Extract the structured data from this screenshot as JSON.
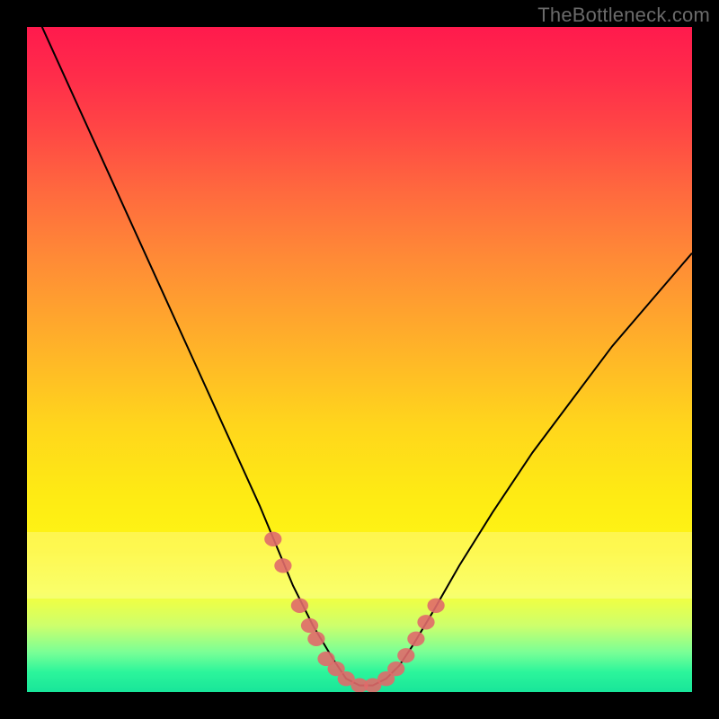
{
  "watermark": "TheBottleneck.com",
  "chart_data": {
    "type": "line",
    "title": "",
    "xlabel": "",
    "ylabel": "",
    "xlim": [
      0,
      100
    ],
    "ylim": [
      0,
      100
    ],
    "series": [
      {
        "name": "bottleneck-curve",
        "x": [
          0,
          5,
          10,
          15,
          20,
          25,
          30,
          35,
          40,
          43,
          46,
          48,
          50,
          52,
          54,
          56,
          58,
          61,
          65,
          70,
          76,
          82,
          88,
          94,
          100
        ],
        "values": [
          105,
          94,
          83,
          72,
          61,
          50,
          39,
          28,
          16,
          10,
          5,
          2,
          1,
          1,
          2,
          4,
          7,
          12,
          19,
          27,
          36,
          44,
          52,
          59,
          66
        ]
      }
    ],
    "markers": {
      "name": "highlight-dots",
      "color": "#e06a6a",
      "points_xy": [
        [
          37,
          23
        ],
        [
          38.5,
          19
        ],
        [
          41,
          13
        ],
        [
          42.5,
          10
        ],
        [
          43.5,
          8
        ],
        [
          45,
          5
        ],
        [
          46.5,
          3.5
        ],
        [
          48,
          2
        ],
        [
          50,
          1
        ],
        [
          52,
          1
        ],
        [
          54,
          2
        ],
        [
          55.5,
          3.5
        ],
        [
          57,
          5.5
        ],
        [
          58.5,
          8
        ],
        [
          60,
          10.5
        ],
        [
          61.5,
          13
        ]
      ]
    },
    "gradient_stops": [
      {
        "pct": 0,
        "color": "#ff1a4d"
      },
      {
        "pct": 15,
        "color": "#ff4545"
      },
      {
        "pct": 35,
        "color": "#ff8b36"
      },
      {
        "pct": 60,
        "color": "#ffd61c"
      },
      {
        "pct": 85,
        "color": "#f8ff3a"
      },
      {
        "pct": 100,
        "color": "#18e59a"
      }
    ]
  }
}
